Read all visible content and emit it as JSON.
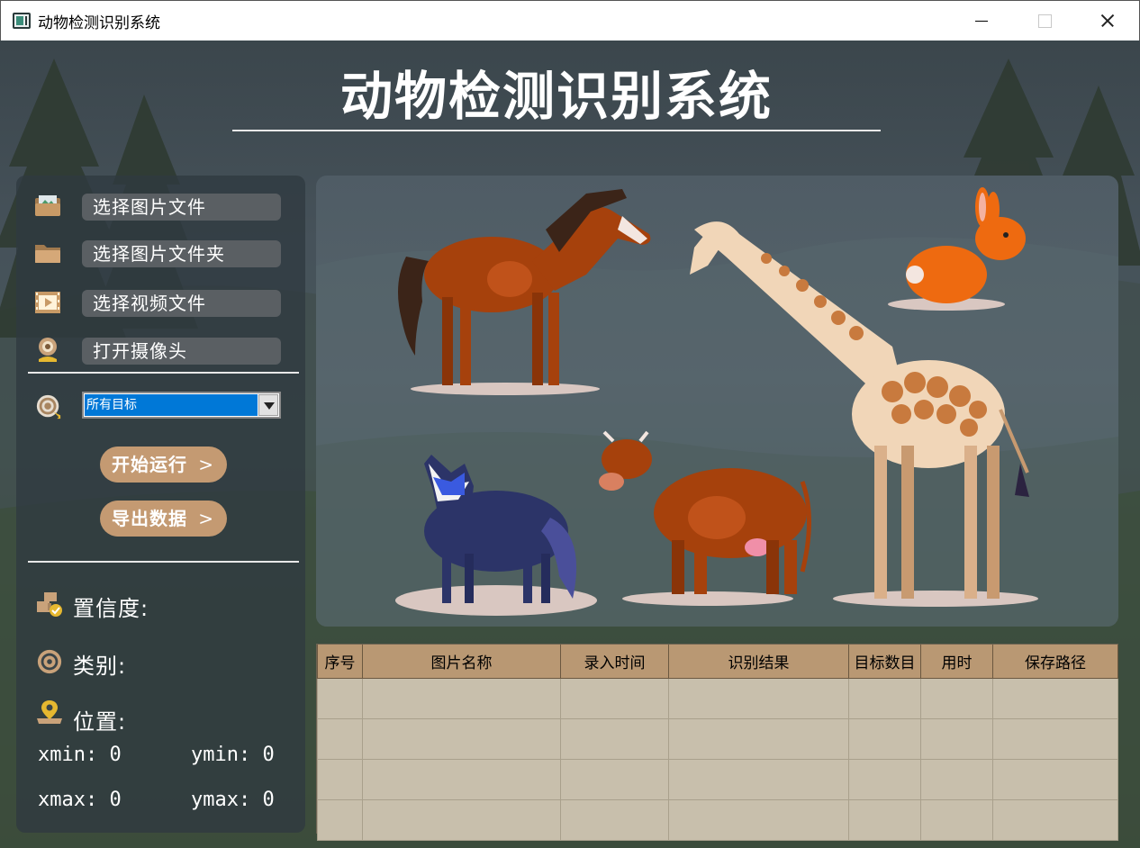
{
  "window": {
    "title": "动物检测识别系统"
  },
  "header": {
    "title": "动物检测识别系统"
  },
  "sidebar": {
    "buttons": [
      {
        "label": "选择图片文件",
        "icon": "image-folder-icon"
      },
      {
        "label": "选择图片文件夹",
        "icon": "folder-icon"
      },
      {
        "label": "选择视频文件",
        "icon": "video-icon"
      },
      {
        "label": "打开摄像头",
        "icon": "camera-icon"
      }
    ],
    "target_select": {
      "icon": "target-icon",
      "value": "所有目标"
    },
    "run_label": "开始运行",
    "export_label": "导出数据",
    "chevron": ">"
  },
  "result": {
    "confidence_label": "置信度:",
    "class_label": "类别:",
    "position_label": "位置:",
    "xmin": "xmin: 0",
    "ymin": "ymin: 0",
    "xmax": "xmax: 0",
    "ymax": "ymax: 0"
  },
  "table": {
    "headers": [
      "序号",
      "图片名称",
      "录入时间",
      "识别结果",
      "目标数目",
      "用时",
      "保存路径"
    ]
  },
  "colors": {
    "button_accent": "#c49a72",
    "table_header": "#b99873",
    "table_body": "#c8bfac",
    "select_highlight": "#0078d7"
  }
}
